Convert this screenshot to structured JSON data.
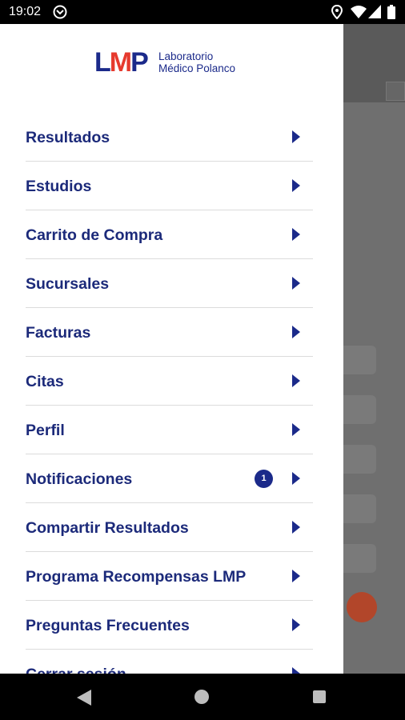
{
  "status_bar": {
    "time": "19:02",
    "icons": [
      "sync-app-icon",
      "location-icon",
      "wifi-icon",
      "signal-icon",
      "battery-icon"
    ]
  },
  "drawer": {
    "logo": {
      "mark_l": "L",
      "mark_m": "M",
      "mark_p": "P",
      "line1": "Laboratorio",
      "line2": "Médico Polanco"
    },
    "items": [
      {
        "label": "Resultados"
      },
      {
        "label": "Estudios"
      },
      {
        "label": "Carrito de Compra"
      },
      {
        "label": "Sucursales"
      },
      {
        "label": "Facturas"
      },
      {
        "label": "Citas"
      },
      {
        "label": "Perfil"
      },
      {
        "label": "Notificaciones",
        "badge": "1"
      },
      {
        "label": "Compartir Resultados"
      },
      {
        "label": "Programa Recompensas LMP"
      },
      {
        "label": "Preguntas Frecuentes"
      },
      {
        "label": "Cerrar sesión"
      }
    ]
  },
  "colors": {
    "brand_blue": "#1b2a8a",
    "menu_text": "#1c2a7a",
    "logo_red": "#e63a2e",
    "fab": "#b2462a",
    "scrim": "#6f6f6f"
  },
  "nav_bar": {
    "icons": [
      "back-icon",
      "home-icon",
      "recents-icon"
    ]
  }
}
